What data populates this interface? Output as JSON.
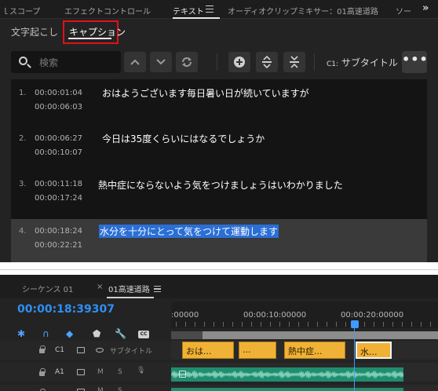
{
  "top_panel": {
    "tabs": [
      {
        "label": "ｌスコープ"
      },
      {
        "label": "エフェクトコントロール"
      },
      {
        "label": "テキスト"
      },
      {
        "label": "オーディオクリップミキサー：01高速道路"
      },
      {
        "label": "ソー"
      }
    ],
    "more_tabs_label": "»",
    "subtabs": {
      "transcript": "文字起こし",
      "caption": "キャプション"
    },
    "search": {
      "placeholder": "検索"
    },
    "track_prefix": "C1:",
    "track_name": "サブタイトル",
    "more_label": "•••",
    "captions": [
      {
        "num": "1.",
        "in": "00:00:01:04",
        "out": "00:00:06:03",
        "text": "おはようございます毎日暑い日が続いていますが"
      },
      {
        "num": "2.",
        "in": "00:00:06:27",
        "out": "00:00:10:07",
        "text": "今日は35度くらいにはなるでしょうか"
      },
      {
        "num": "3.",
        "in": "00:00:11:18",
        "out": "00:00:17:24",
        "text": "熱中症にならないよう気をつけましょうはいわかりました"
      },
      {
        "num": "4.",
        "in": "00:00:18:24",
        "out": "00:00:22:21",
        "text": "水分を十分にとって気をつけて運動します"
      }
    ],
    "selected_caption_index": 4
  },
  "timeline": {
    "tab_sequence": "シーケンス 01",
    "tab_close": "×",
    "tab_active": "01高速道路",
    "timecode": "00:00:18:39307",
    "ruler_labels": [
      ":00000",
      "00:00:10:00000",
      "00:00:20:00000"
    ],
    "tracks": {
      "c1": {
        "id": "C1",
        "name": "サブタイトル"
      },
      "a1": {
        "id": "A1",
        "m": "M",
        "s": "S"
      },
      "a2": {
        "m": "M",
        "s": "S"
      }
    },
    "caption_clips": [
      "おは...",
      "...",
      "熱中症...",
      "水..."
    ]
  },
  "colors": {
    "accent_blue": "#2f8ff0",
    "highlight_red": "#e0101a",
    "caption_clip": "#f0b236",
    "audio_clip": "#1f8d6f",
    "selection": "#2a6fd6"
  }
}
